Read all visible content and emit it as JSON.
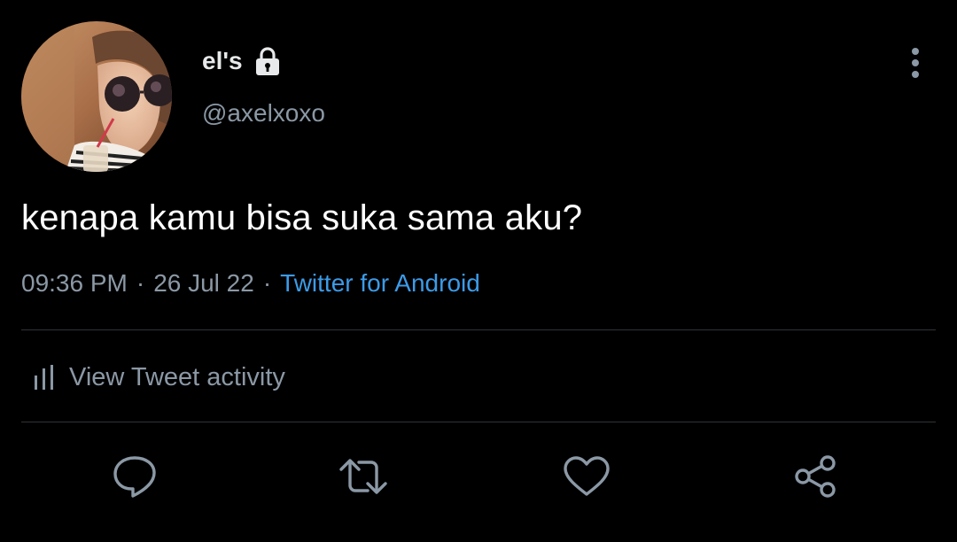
{
  "tweet": {
    "display_name": "el's",
    "handle": "@axelxoxo",
    "text": "kenapa kamu bisa suka sama aku?",
    "time": "09:36 PM",
    "date": "26 Jul 22",
    "separator": "·",
    "source": "Twitter for Android",
    "protected": true
  },
  "activity": {
    "label": "View Tweet activity"
  },
  "actions": [
    "reply-icon",
    "retweet-icon",
    "like-icon",
    "share-icon"
  ],
  "colors": {
    "background": "#000000",
    "text": "#ffffff",
    "secondary_text": "#8b98a5",
    "link": "#3c9be8",
    "divider": "#2f3336"
  }
}
